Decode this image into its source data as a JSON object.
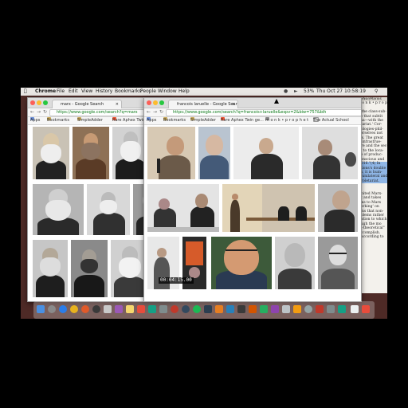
{
  "menubar": {
    "app": "Chrome",
    "items": [
      "File",
      "Edit",
      "View",
      "History",
      "Bookmarks",
      "People",
      "Window",
      "Help"
    ],
    "clock": "Thu Oct 27  10:58:19",
    "battery": "53%"
  },
  "window_left": {
    "tab_title": "marx - Google Search",
    "url": "https://www.google.com/search?q=marx",
    "bookmarks": [
      "Apps",
      "Bookmarks",
      "SimpleAdder",
      "Rare Aphex Twin ge"
    ]
  },
  "window_right": {
    "tab_title": "francois laruelle - Google Sear",
    "url": "https://www.google.com/search?q=francois+laruelle&espv=2&biw=757&bih",
    "bookmarks": [
      "Apps",
      "Bookmarks",
      "SimpleAdder",
      "Rare Aphex Twin ge...",
      "m o n k • p r o p h e t",
      "The Actual School"
    ]
  },
  "document": {
    "header": "lleNonMarxis",
    "lines": [
      "n o n k • p r o p h e t",
      "",
      "r the class-sub-",
      "ze that subtit",
      "asa—with the",
      "etariat.' Cor-",
      "nologies-phil-",
      "cerselves not",
      "r s. The great",
      "d infrastrue-",
      "ure and the sec-",
      "lg to the loca-",
      "ce of produc-",
      "conscious and",
      "2016.\"(4) In",
      "ctions's double fi",
      "us, it is hum-",
      "d unilateral and",
      "Proletariat.",
      "",
      "",
      "finited Marx-",
      "rx and takes",
      "rms to Marx",
      "eorking' on",
      "ems that non-",
      "oblems rather",
      "uation to which",
      "ough the mo",
      "id-theoretical\"",
      "accomplish.",
      "/ according to"
    ]
  },
  "video_timestamp": "00:04:15.00",
  "colors": {
    "accent": "#4285f4",
    "menubar": "#e9e7e4",
    "desktop": "#4e2a26"
  }
}
